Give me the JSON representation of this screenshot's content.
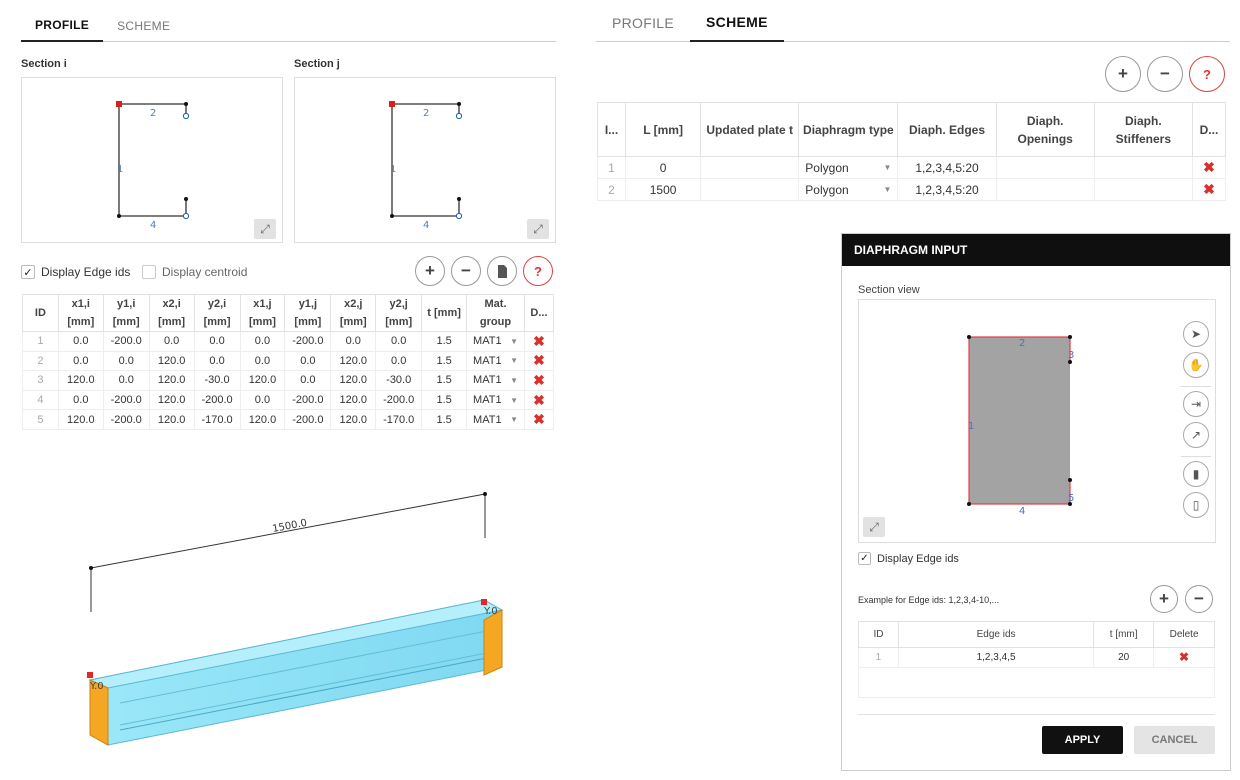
{
  "left_tabs": [
    "PROFILE",
    "SCHEME"
  ],
  "right_tabs": [
    "PROFILE",
    "SCHEME"
  ],
  "section_i": {
    "label": "Section i",
    "edge_labels": [
      "2",
      "1",
      "4"
    ]
  },
  "section_j": {
    "label": "Section j",
    "edge_labels": [
      "2",
      "1",
      "4"
    ]
  },
  "display_edge_ids": "Display Edge ids",
  "display_centroid": "Display centroid",
  "edge_table": {
    "headers": [
      "ID",
      "x1,i [mm]",
      "y1,i [mm]",
      "x2,i [mm]",
      "y2,i [mm]",
      "x1,j [mm]",
      "y1,j [mm]",
      "x2,j [mm]",
      "y2,j [mm]",
      "t [mm]",
      "Mat. group",
      "D..."
    ],
    "rows": [
      [
        "1",
        "0.0",
        "-200.0",
        "0.0",
        "0.0",
        "0.0",
        "-200.0",
        "0.0",
        "0.0",
        "1.5",
        "MAT1"
      ],
      [
        "2",
        "0.0",
        "0.0",
        "120.0",
        "0.0",
        "0.0",
        "0.0",
        "120.0",
        "0.0",
        "1.5",
        "MAT1"
      ],
      [
        "3",
        "120.0",
        "0.0",
        "120.0",
        "-30.0",
        "120.0",
        "0.0",
        "120.0",
        "-30.0",
        "1.5",
        "MAT1"
      ],
      [
        "4",
        "0.0",
        "-200.0",
        "120.0",
        "-200.0",
        "0.0",
        "-200.0",
        "120.0",
        "-200.0",
        "1.5",
        "MAT1"
      ],
      [
        "5",
        "120.0",
        "-200.0",
        "120.0",
        "-170.0",
        "120.0",
        "-200.0",
        "120.0",
        "-170.0",
        "1.5",
        "MAT1"
      ]
    ]
  },
  "beam_view": {
    "dimension": "1500.0",
    "label_left": "Y.0",
    "label_right": "Y.0"
  },
  "scheme_table": {
    "headers": [
      "I...",
      "L [mm]",
      "Updated plate t",
      "Diaphragm type",
      "Diaph. Edges",
      "Diaph. Openings",
      "Diaph. Stiffeners",
      "D..."
    ],
    "rows": [
      [
        "1",
        "0",
        "",
        "Polygon",
        "1,2,3,4,5:20",
        "",
        ""
      ],
      [
        "2",
        "1500",
        "",
        "Polygon",
        "1,2,3,4,5:20",
        "",
        ""
      ]
    ]
  },
  "diaphragm": {
    "title": "DIAPHRAGM INPUT",
    "section_view_label": "Section view",
    "edge_labels": [
      "2",
      "3",
      "1",
      "5",
      "4"
    ],
    "display_edge_ids": "Display Edge ids",
    "example": "Example for Edge ids: 1,2,3,4-10,...",
    "table_headers": [
      "ID",
      "Edge ids",
      "t [mm]",
      "Delete"
    ],
    "table_rows": [
      [
        "1",
        "1,2,3,4,5",
        "20"
      ]
    ],
    "apply": "APPLY",
    "cancel": "CANCEL"
  },
  "icons": {
    "plus": "plus-icon",
    "minus": "minus-icon",
    "help": "help-icon",
    "file": "file-icon",
    "delete": "delete-x-icon"
  },
  "colors": {
    "accent_red": "#d9302c",
    "beam_blue": "#8fe3f6",
    "beam_end": "#f5a623",
    "diaphragm_fill": "#a3a3a3"
  }
}
